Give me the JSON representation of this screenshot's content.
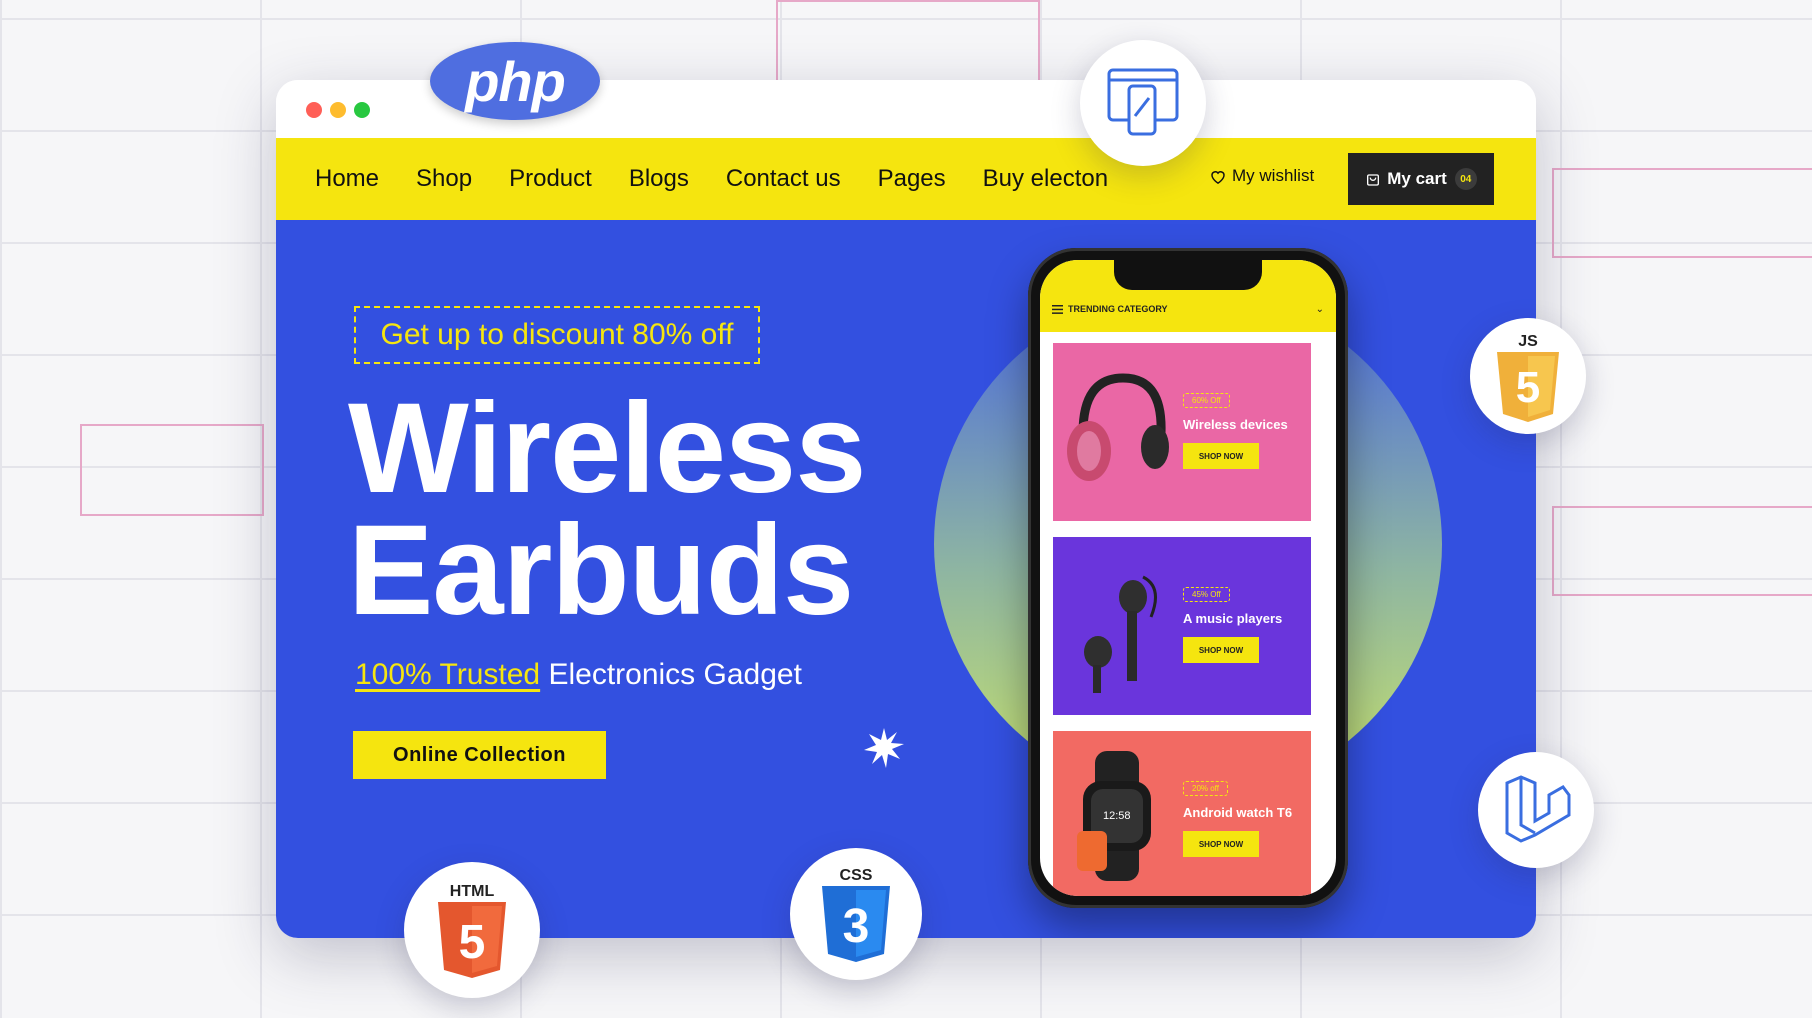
{
  "browser": {
    "controls": [
      "close",
      "minimize",
      "maximize"
    ]
  },
  "nav": {
    "links": [
      "Home",
      "Shop",
      "Product",
      "Blogs",
      "Contact us",
      "Pages",
      "Buy electon"
    ],
    "wishlist_label": "My wishlist",
    "cart_label": "My cart",
    "cart_count": "04"
  },
  "hero": {
    "promo": "Get up to discount 80% off",
    "headline_line1": "Wireless",
    "headline_line2": "Earbuds",
    "subline_highlight": "100% Trusted",
    "subline_rest": " Electronics Gadget",
    "cta_label": "Online Collection"
  },
  "phone": {
    "category_label": "TRENDING CATEGORY",
    "cards": [
      {
        "badge": "60% Off",
        "title": "Wireless devices",
        "button": "SHOP NOW"
      },
      {
        "badge": "45% Off",
        "title": "A music players",
        "button": "SHOP NOW"
      },
      {
        "badge": "20% off",
        "title": "Android watch T6",
        "button": "SHOP NOW"
      }
    ]
  },
  "badges": {
    "php": "php",
    "html": "HTML",
    "html_num": "5",
    "css": "CSS",
    "css_num": "3",
    "js": "JS",
    "js_num": "5"
  },
  "colors": {
    "brand_yellow": "#f5e50f",
    "hero_blue": "#3350e0",
    "cart_dark": "#222222"
  }
}
